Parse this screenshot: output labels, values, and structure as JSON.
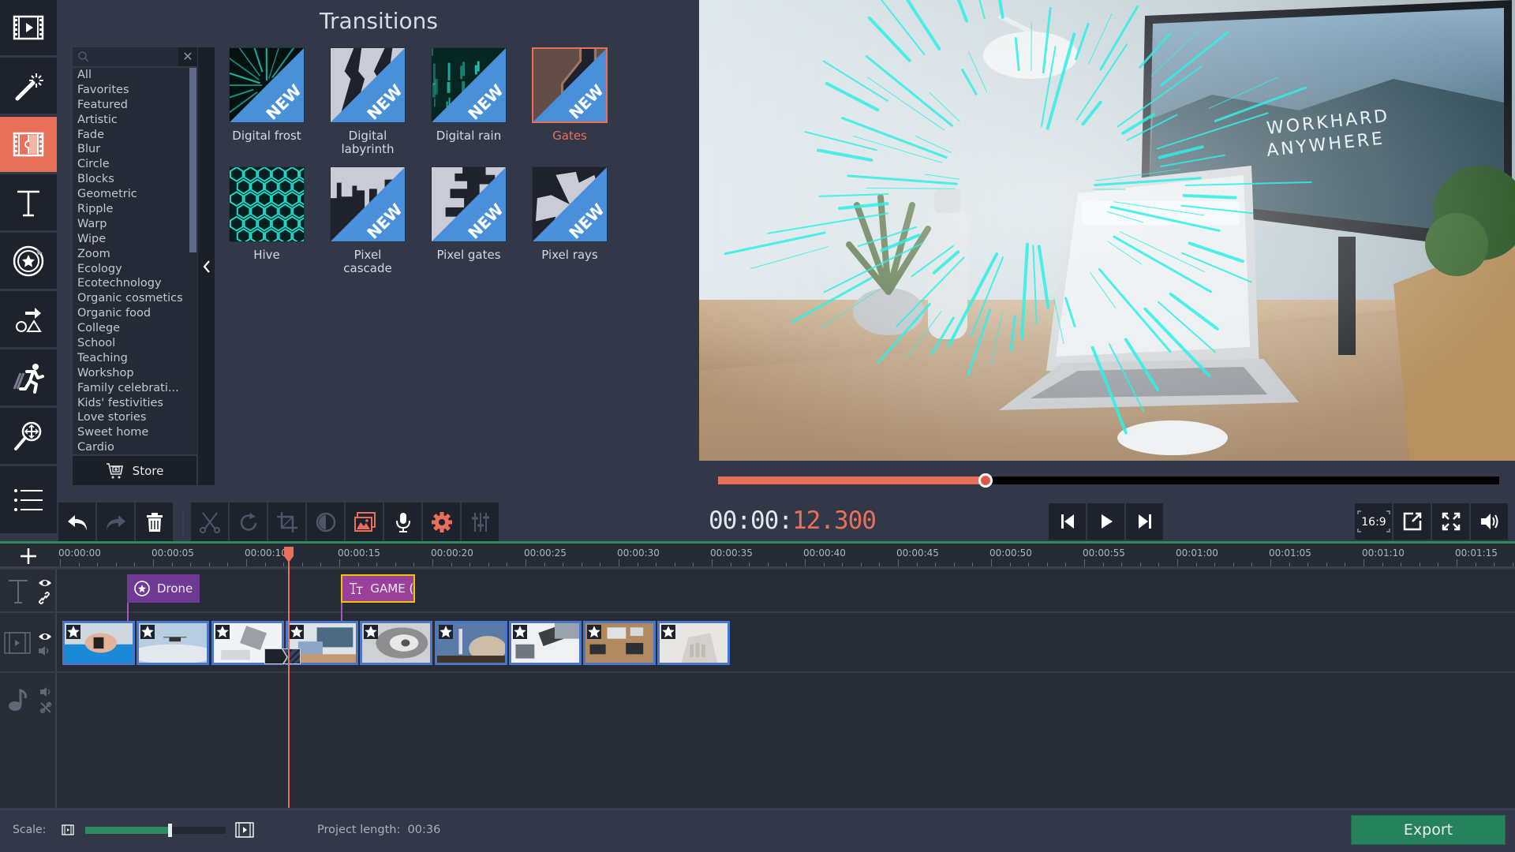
{
  "sidebar": {
    "items": [
      {
        "name": "import",
        "icon": "film-play-icon",
        "active": false
      },
      {
        "name": "filters",
        "icon": "magic-wand-icon",
        "active": false
      },
      {
        "name": "transitions",
        "icon": "film-puzzle-icon",
        "active": true
      },
      {
        "name": "titles",
        "icon": "text-t-icon",
        "active": false
      },
      {
        "name": "stickers",
        "icon": "sticker-star-icon",
        "active": false
      },
      {
        "name": "callouts",
        "icon": "shapes-arrow-icon",
        "active": false
      },
      {
        "name": "motion",
        "icon": "running-man-icon",
        "active": false
      },
      {
        "name": "zoom-pan",
        "icon": "zoom-move-icon",
        "active": false
      },
      {
        "name": "more",
        "icon": "list-icon",
        "active": false
      }
    ]
  },
  "transitions_panel": {
    "title": "Transitions",
    "search_placeholder": "",
    "categories": [
      "All",
      "Favorites",
      "Featured",
      "Artistic",
      "Fade",
      "Blur",
      "Circle",
      "Blocks",
      "Geometric",
      "Ripple",
      "Warp",
      "Wipe",
      "Zoom",
      "Ecology",
      "Ecotechnology",
      "Organic cosmetics",
      "Organic food",
      "College",
      "School",
      "Teaching",
      "Workshop",
      "Family celebrati...",
      "Kids' festivities",
      "Love stories",
      "Sweet home",
      "Cardio"
    ],
    "store_label": "Store",
    "items": [
      {
        "label": "Digital frost",
        "badge": "NEW",
        "selected": false
      },
      {
        "label": "Digital labyrinth",
        "badge": "NEW",
        "selected": false
      },
      {
        "label": "Digital rain",
        "badge": "NEW",
        "selected": false
      },
      {
        "label": "Gates",
        "badge": "NEW",
        "selected": true
      },
      {
        "label": "Hive",
        "badge": "",
        "selected": false
      },
      {
        "label": "Pixel cascade",
        "badge": "NEW",
        "selected": false
      },
      {
        "label": "Pixel gates",
        "badge": "NEW",
        "selected": false
      },
      {
        "label": "Pixel rays",
        "badge": "NEW",
        "selected": false
      }
    ]
  },
  "preview": {
    "scene_text_line1": "WORKHARD",
    "scene_text_line2": "ANYWHERE",
    "progress_fraction": 0.342,
    "time_prefix": "00:00:",
    "time_ms": "12.300",
    "aspect_label": "16:9"
  },
  "toolbar": {
    "buttons": [
      "undo",
      "redo",
      "delete",
      "cut",
      "rotate",
      "crop",
      "color-adjust",
      "clip-properties",
      "record-voice",
      "settings",
      "audio-equalizer"
    ]
  },
  "timeline": {
    "ruler_labels": [
      "00:00:00",
      "00:00:05",
      "00:00:10",
      "00:00:15",
      "00:00:20",
      "00:00:25",
      "00:00:30",
      "00:00:35",
      "00:00:40",
      "00:00:45",
      "00:00:50",
      "00:00:55",
      "00:01:00",
      "00:01:05",
      "00:01:10",
      "00:01:15"
    ],
    "playhead_seconds": 12.3,
    "title_clips": [
      {
        "label": "Drone",
        "icon": "sticker-icon",
        "start_seconds": 3.6,
        "color": "#6e3a94"
      },
      {
        "label": "GAME (",
        "icon": "title-tt-icon",
        "start_seconds": 15.1,
        "color": "#9a3f9a",
        "selected": true
      }
    ],
    "video_clips": [
      {
        "name": "smartwatch"
      },
      {
        "name": "drone"
      },
      {
        "name": "office-desk"
      },
      {
        "name": "laptop-workspace"
      },
      {
        "name": "tunnel"
      },
      {
        "name": "rocket-launch"
      },
      {
        "name": "laptop-hands"
      },
      {
        "name": "meeting-table"
      },
      {
        "name": "robot-hand"
      }
    ]
  },
  "status_bar": {
    "scale_label": "Scale:",
    "scale_fraction": 0.6,
    "project_length_label": "Project length:",
    "project_length_value": "00:36",
    "export_label": "Export"
  },
  "colors": {
    "accent": "#e86f5a",
    "export_green": "#25825d",
    "clip_border": "#4a76c9",
    "new_badge": "#4a90d9"
  }
}
